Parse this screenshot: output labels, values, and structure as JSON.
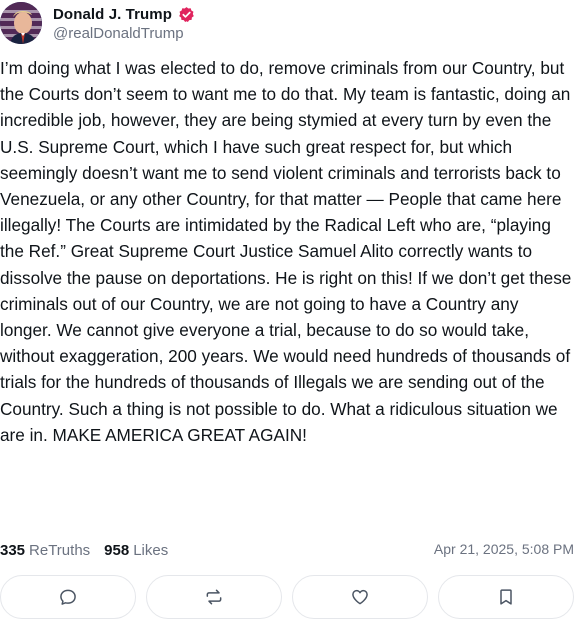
{
  "author": {
    "display_name": "Donald J. Trump",
    "handle": "@realDonaldTrump",
    "verified": true,
    "verified_badge_color": "#e0245e"
  },
  "post": {
    "text": "I’m doing what I was elected to do, remove criminals from our Country, but the Courts don’t seem to want me to do that. My team is fantastic, doing an incredible job, however, they are being stymied at every turn by even the U.S. Supreme Court, which I have such great respect for, but which seemingly doesn’t want me to send violent criminals and terrorists back to Venezuela, or any other Country, for that matter — People that came here illegally! The Courts are intimidated by the Radical Left who are, “playing the Ref.” Great Supreme Court Justice Samuel Alito correctly wants to dissolve the pause on deportations. He is right on this! If we don’t get these criminals out of our Country, we are not going to have a Country any longer. We cannot give everyone a trial, because to do so would take, without exaggeration, 200 years. We would need hundreds of thousands of trials for the hundreds of thousands of Illegals we are sending out of the Country. Such a thing is not possible to do. What a ridiculous situation we are in. MAKE AMERICA GREAT AGAIN!"
  },
  "stats": {
    "retruths_count": "335",
    "retruths_label": "ReTruths",
    "likes_count": "958",
    "likes_label": "Likes",
    "timestamp": "Apr 21, 2025, 5:08 PM"
  },
  "actions": [
    {
      "name": "reply",
      "icon": "reply-icon"
    },
    {
      "name": "retruth",
      "icon": "retruth-icon"
    },
    {
      "name": "like",
      "icon": "heart-icon"
    },
    {
      "name": "bookmark",
      "icon": "bookmark-icon"
    }
  ],
  "colors": {
    "text_primary": "#0f1419",
    "text_secondary": "#6b7280",
    "border": "#e5e7eb"
  }
}
